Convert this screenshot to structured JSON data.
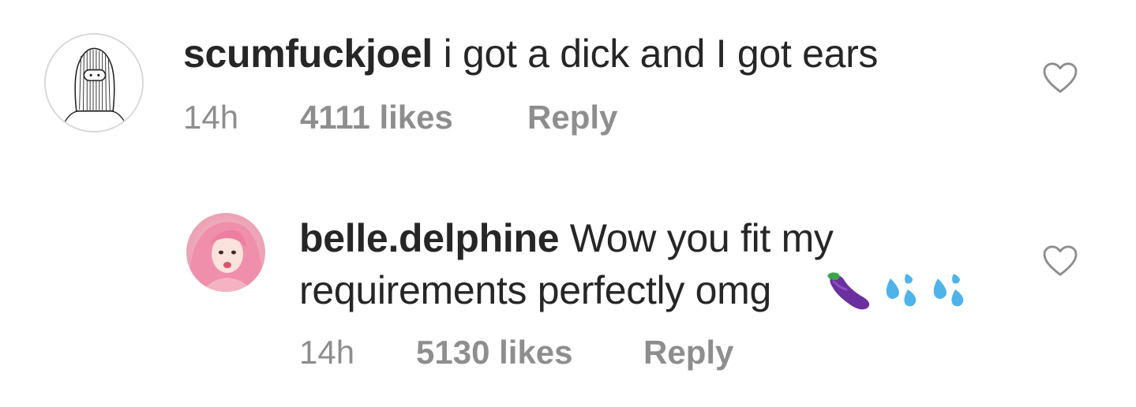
{
  "comments": [
    {
      "username": "scumfuckjoel",
      "text": "i got a dick and I got ears",
      "time": "14h",
      "likes": "4111 likes",
      "reply_label": "Reply",
      "avatar_icon": "sketch-avatar-icon",
      "like_icon": "heart-outline-icon"
    },
    {
      "username": "belle.delphine",
      "text_line1": "Wow you fit my",
      "text_line2": "requirements perfectly omg",
      "emojis": [
        "eggplant-emoji",
        "sweat-droplets-emoji",
        "sweat-droplets-emoji"
      ],
      "time": "14h",
      "likes": "5130 likes",
      "reply_label": "Reply",
      "avatar_icon": "photo-avatar-icon",
      "like_icon": "heart-outline-icon"
    }
  ],
  "colors": {
    "text": "#262626",
    "meta": "#8e8e8e",
    "heart_stroke": "#8e8e8e",
    "eggplant": "#6b2fa0",
    "droplet": "#4fb3ea"
  }
}
